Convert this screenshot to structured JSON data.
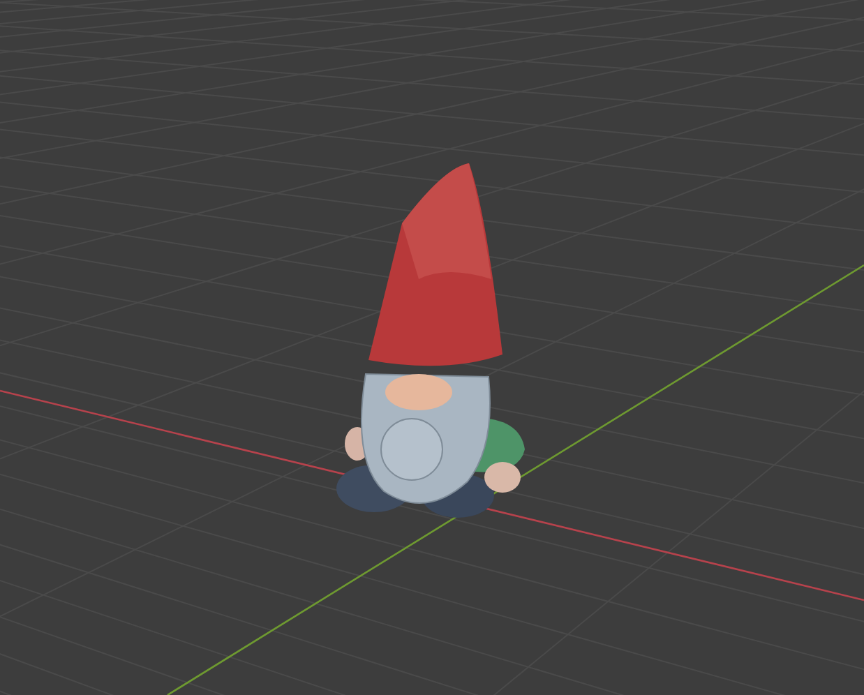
{
  "viewport": {
    "axes": [
      {
        "kind": "x",
        "color": "#b7424c"
      },
      {
        "kind": "y",
        "color": "#6e9a30"
      }
    ]
  }
}
